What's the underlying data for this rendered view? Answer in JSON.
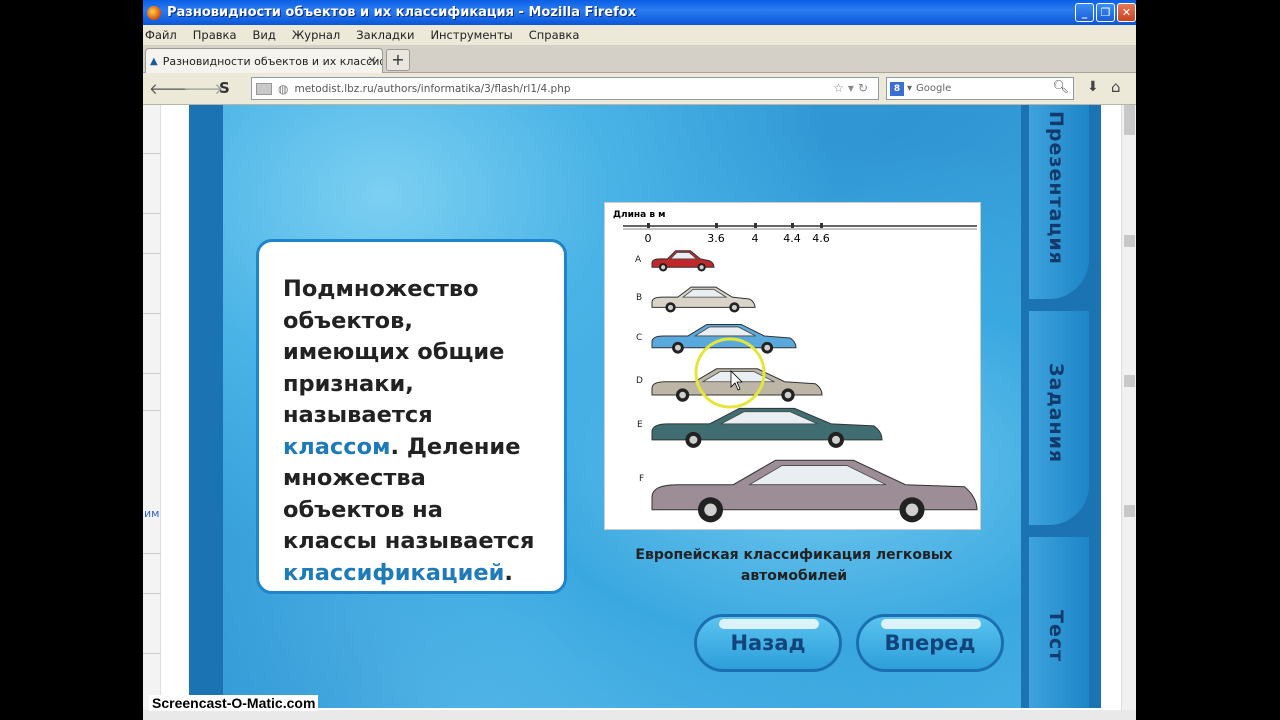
{
  "window": {
    "title": "Разновидности объектов и их классификация - Mozilla Firefox",
    "controls": [
      "_",
      "❐",
      "✕"
    ]
  },
  "menu": [
    "Файл",
    "Правка",
    "Вид",
    "Журнал",
    "Закладки",
    "Инструменты",
    "Справка"
  ],
  "tab": {
    "label": "Разновидности объектов и их классифик...",
    "close": "×",
    "new_tab": "+"
  },
  "nav": {
    "url": "metodist.lbz.ru/authors/informatika/3/flash/rl1/4.php",
    "search_placeholder": "Google"
  },
  "left_link": "им",
  "definition": {
    "part1": "Подмножество объектов, имеющих общие признаки, называется ",
    "term1": "классом",
    "part2": ". Деление множества объектов на классы называется ",
    "term2": "классификацией",
    "part3": "."
  },
  "figure": {
    "axis_title": "Длина в м",
    "ticks": [
      "0",
      "3.6",
      "4",
      "4.4",
      "4.6"
    ],
    "rows": [
      "A",
      "B",
      "C",
      "D",
      "E",
      "F"
    ],
    "car_colors": [
      "#c0282a",
      "#d9d3c8",
      "#5aa9dc",
      "#bdb6a6",
      "#3f6d72",
      "#9c8d96"
    ],
    "caption": "Европейская классификация легковых автомобилей"
  },
  "side_tabs": [
    "Презентация",
    "Задания",
    "Тест"
  ],
  "buttons": {
    "back": "Назад",
    "forward": "Вперед"
  },
  "watermark": "Screencast-O-Matic.com"
}
